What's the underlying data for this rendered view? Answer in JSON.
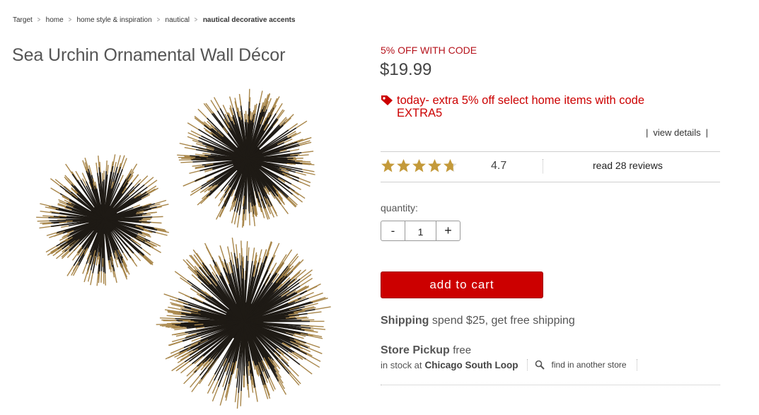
{
  "breadcrumb": [
    {
      "label": "Target"
    },
    {
      "label": "home"
    },
    {
      "label": "home style & inspiration"
    },
    {
      "label": "nautical"
    },
    {
      "label": "nautical decorative accents"
    }
  ],
  "product": {
    "title": "Sea Urchin Ornamental Wall Décor",
    "promo_code_text": "5% OFF WITH CODE",
    "price": "$19.99",
    "offer_line1": "today- extra 5% off select home items with code",
    "offer_line2": "EXTRA5",
    "view_details": "view details"
  },
  "rating": {
    "value": "4.7",
    "stars_filled_fraction": 0.94,
    "reviews_link": "read 28 reviews"
  },
  "quantity": {
    "label": "quantity:",
    "minus": "-",
    "value": "1",
    "plus": "+"
  },
  "cart": {
    "add_label": "add to cart"
  },
  "shipping": {
    "label": "Shipping",
    "text": "spend $25, get free shipping"
  },
  "pickup": {
    "label": "Store Pickup",
    "free": "free",
    "stock_prefix": "in stock at",
    "store": "Chicago South Loop",
    "find_other": "find in another store"
  },
  "colors": {
    "accent_red": "#cc0000",
    "button_red": "#cc0000",
    "star_gold": "#c49a3a"
  },
  "icons": {
    "breadcrumb_separator": "chevron-right-icon",
    "offer": "price-tag-icon",
    "find_store": "search-icon"
  }
}
